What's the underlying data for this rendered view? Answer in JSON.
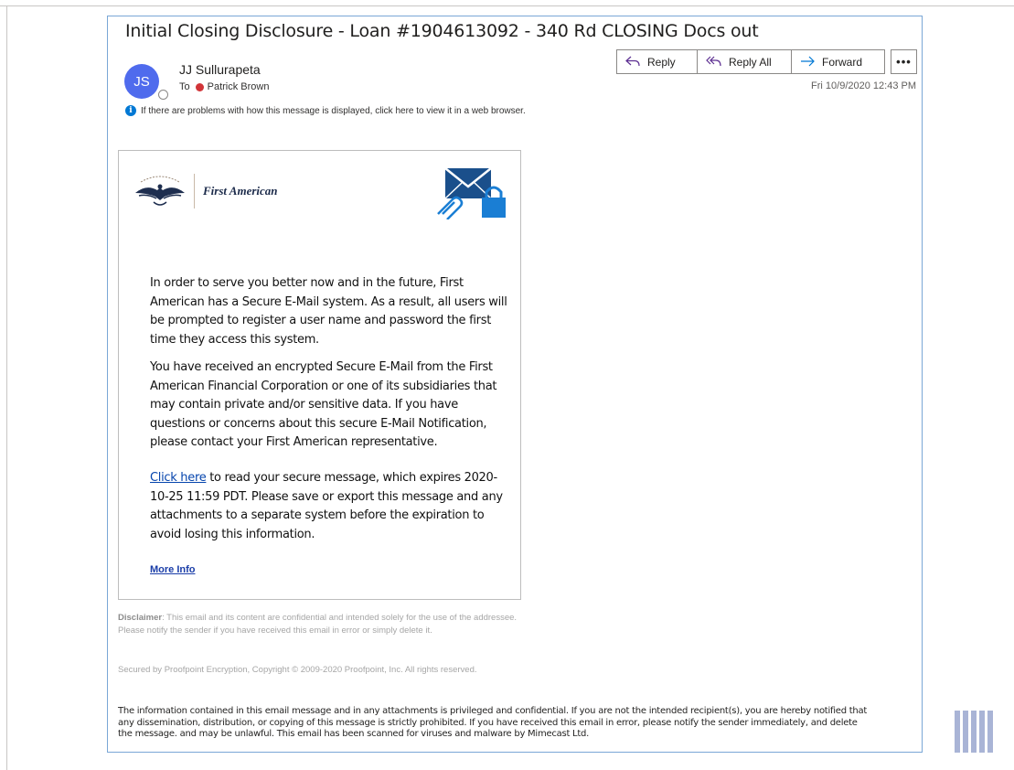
{
  "email": {
    "subject": "Initial Closing Disclosure - Loan #1904613092 - 340 Rd CLOSING Docs out",
    "sender": {
      "initials": "JS",
      "name": "JJ Sullurapeta"
    },
    "to_label": "To",
    "recipient": "Patrick Brown",
    "date": "Fri 10/9/2020 12:43 PM",
    "info_bar": "If there are problems with how this message is displayed, click here to view it in a web browser."
  },
  "toolbar": {
    "reply_label": "Reply",
    "reply_all_label": "Reply All",
    "forward_label": "Forward",
    "more_label": "•••"
  },
  "body": {
    "logo_text": "First American",
    "p1": "In order to serve you better now and in the future, First American has a Secure E-Mail system. As a result, all users will be prompted to register a user name and password the first time they access this system.",
    "p2": "You have received an encrypted Secure E-Mail from the First American Financial Corporation or one of its subsidiaries that may contain private and/or sensitive data. If you have questions or concerns about this secure E-Mail Notification, please contact your First American representative.",
    "p3_link": "Click here",
    "p3_rest": " to read your secure message, which expires 2020-10-25 11:59 PDT. Please save or export this message and any attachments to a separate system before the expiration to avoid losing this information.",
    "more_info": "More Info"
  },
  "footer": {
    "disclaimer_label": "Disclaimer",
    "disclaimer_text": ": This email and its content are confidential and intended solely for the use of the addressee. Please notify the sender if you have received this email in error or simply delete it.",
    "secured": "Secured by Proofpoint Encryption, Copyright © 2009-2020 Proofpoint, Inc. All rights reserved.",
    "legal": "The information contained in this email message and in any attachments is privileged and confidential. If you are not the intended recipient(s), you are hereby notified that any dissemination, distribution, or copying of this message is strictly prohibited. If you have received this email in error, please notify the sender immediately, and delete the message. and may be unlawful. This email has been scanned for viruses and malware by Mimecast Ltd."
  },
  "colors": {
    "avatar": "#4f6bed",
    "presence_red": "#d13438",
    "accent_blue": "#0078d4",
    "reply_purple": "#5c2e91"
  },
  "icons": [
    "reply-icon",
    "reply-all-icon",
    "forward-icon",
    "info-icon",
    "envelope-lock-icon",
    "eagle-logo-icon",
    "watermark-icon"
  ]
}
